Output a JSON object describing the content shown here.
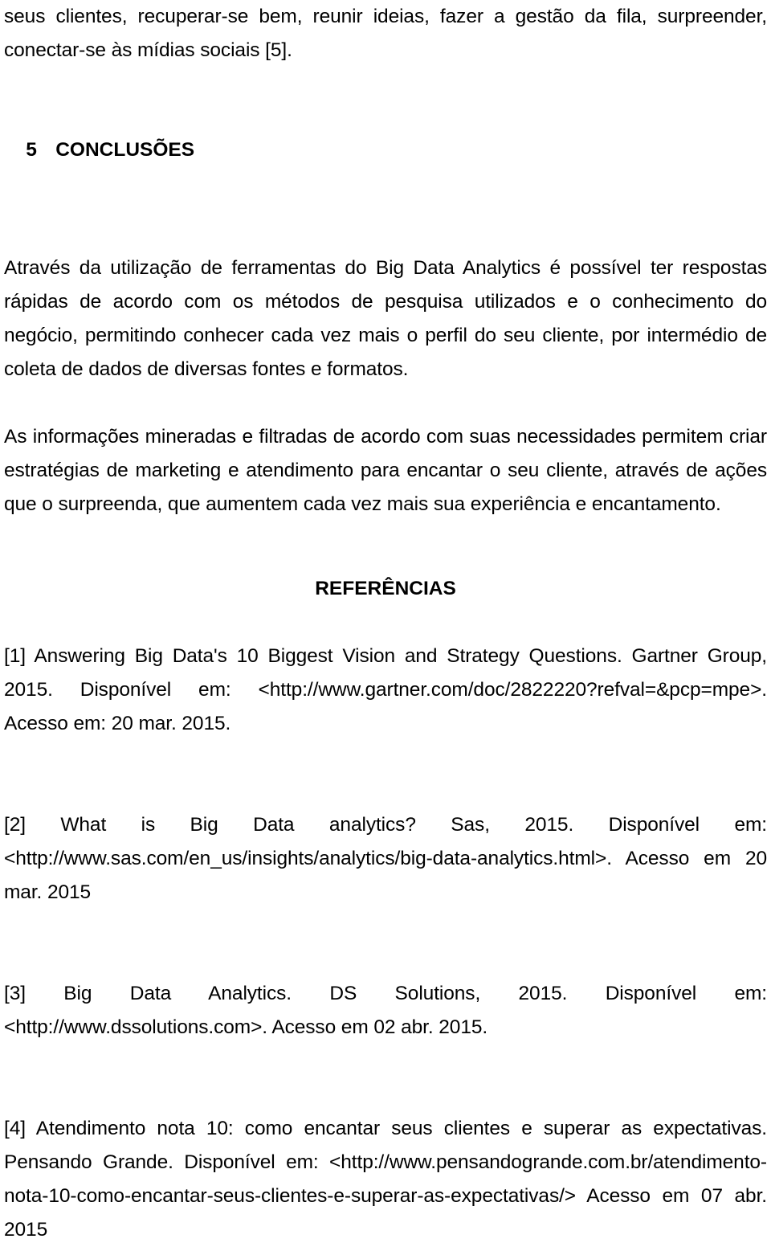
{
  "document": {
    "continued_paragraph": "seus clientes, recuperar-se bem, reunir ideias, fazer a gestão da fila, surpreender, conectar-se às mídias sociais [5].",
    "section": {
      "number": "5",
      "title": "CONCLUSÕES"
    },
    "paragraphs": [
      "Através da utilização de ferramentas do Big Data Analytics é possível ter respostas rápidas de acordo com os métodos de pesquisa utilizados e o conhecimento do negócio, permitindo conhecer cada vez mais o perfil do seu cliente, por intermédio de coleta de dados de diversas fontes e formatos.",
      "As informações mineradas e filtradas de acordo com suas necessidades permitem criar estratégias de marketing e atendimento para encantar o seu cliente, através de ações que o surpreenda, que aumentem cada vez mais sua experiência e encantamento."
    ],
    "references_heading": "REFERÊNCIAS",
    "references": [
      "[1] Answering Big Data's 10 Biggest Vision and Strategy Questions. Gartner Group, 2015. Disponível em: <http://www.gartner.com/doc/2822220?refval=&pcp=mpe>. Acesso em: 20 mar. 2015.",
      "[2] What is Big Data analytics? Sas, 2015. Disponível em: <http://www.sas.com/en_us/insights/analytics/big-data-analytics.html>. Acesso em 20 mar. 2015",
      "[3] Big Data Analytics. DS Solutions, 2015. Disponível em: <http://www.dssolutions.com>. Acesso em 02 abr. 2015.",
      "[4] Atendimento nota 10: como encantar seus clientes e superar as expectativas. Pensando Grande. Disponível em: <http://www.pensandogrande.com.br/atendimento-nota-10-como-encantar-seus-clientes-e-superar-as-expectativas/> Acesso em 07 abr. 2015"
    ]
  }
}
